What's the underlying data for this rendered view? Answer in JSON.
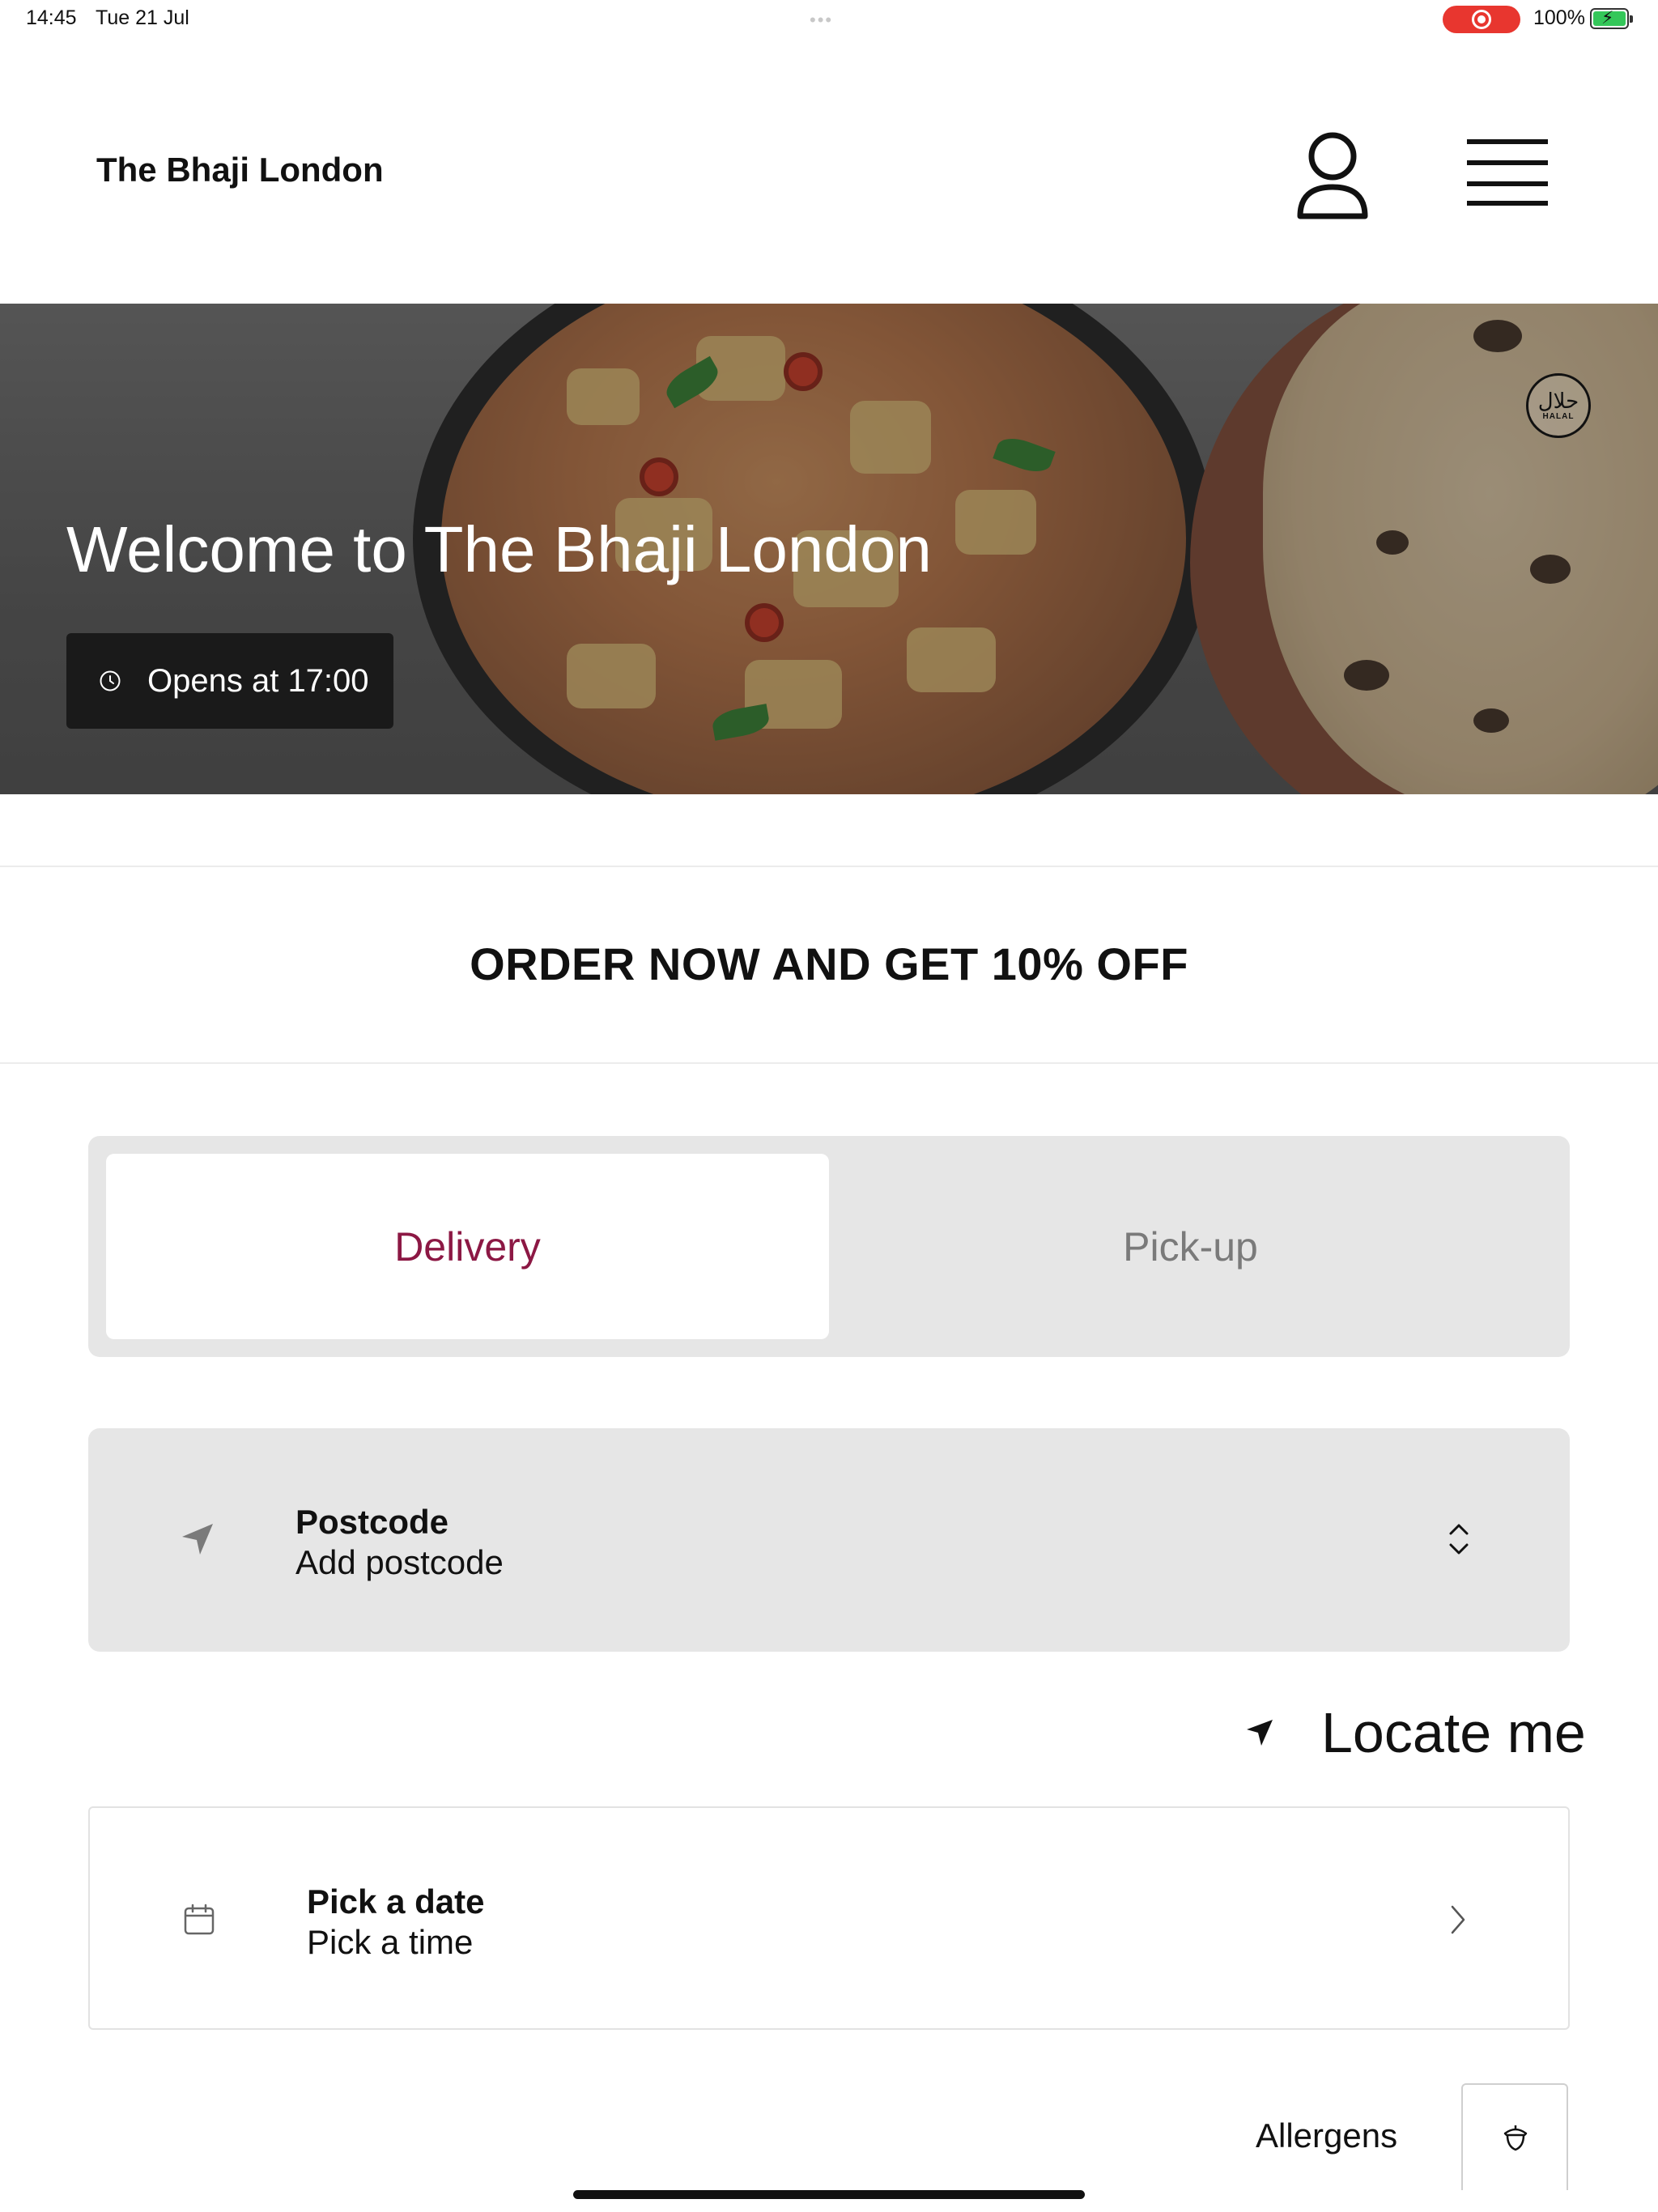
{
  "status_bar": {
    "time": "14:45",
    "date": "Tue 21 Jul",
    "battery": "100%"
  },
  "header": {
    "brand": "The Bhaji London",
    "account_icon": "person-icon",
    "menu_icon": "hamburger-menu-icon"
  },
  "hero": {
    "title": "Welcome to The Bhaji London",
    "hours": "Opens at 17:00",
    "badge_arabic": "حلال",
    "badge_latin": "HALAL"
  },
  "promo": {
    "text": "ORDER NOW AND GET 10% OFF"
  },
  "order_mode": {
    "options": [
      "Delivery",
      "Pick-up"
    ],
    "selected": "Delivery"
  },
  "postcode": {
    "title": "Postcode",
    "value": "Add postcode"
  },
  "locate": {
    "label": "Locate me"
  },
  "schedule": {
    "title": "Pick a date",
    "value": "Pick a time"
  },
  "allergens": {
    "label": "Allergens"
  },
  "colors": {
    "accent": "#8c1844",
    "toggle_bg": "#e6e6e6",
    "hours_chip_bg": "#1a1a1a",
    "record": "#e8362f"
  }
}
